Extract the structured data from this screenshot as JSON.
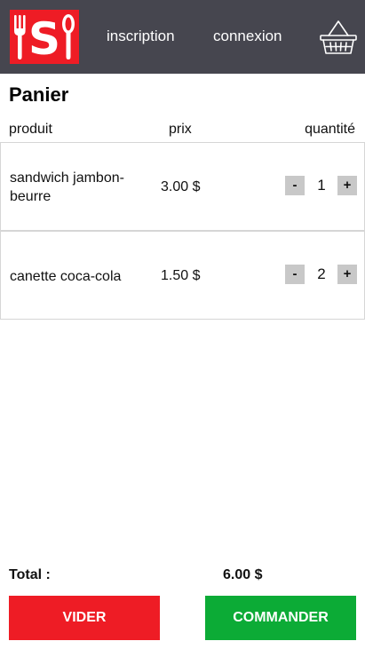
{
  "header": {
    "logo_icon": "restaurant-logo-icon",
    "nav": {
      "inscription": "inscription",
      "connexion": "connexion"
    },
    "cart_icon": "basket-icon",
    "colors": {
      "bar": "#46464f",
      "logo": "#ee1c25"
    }
  },
  "page_title": "Panier",
  "columns": {
    "product": "produit",
    "price": "prix",
    "quantity": "quantité"
  },
  "items": [
    {
      "name": "sandwich jambon-beurre",
      "price": "3.00 $",
      "quantity": "1",
      "minus": "-",
      "plus": "+"
    },
    {
      "name": "canette coca-cola",
      "price": "1.50 $",
      "quantity": "2",
      "minus": "-",
      "plus": "+"
    }
  ],
  "total": {
    "label": "Total :",
    "value": "6.00 $"
  },
  "actions": {
    "clear": "VIDER",
    "order": "COMMANDER"
  },
  "colors": {
    "clear": "#ee1c25",
    "order": "#0cab36"
  }
}
